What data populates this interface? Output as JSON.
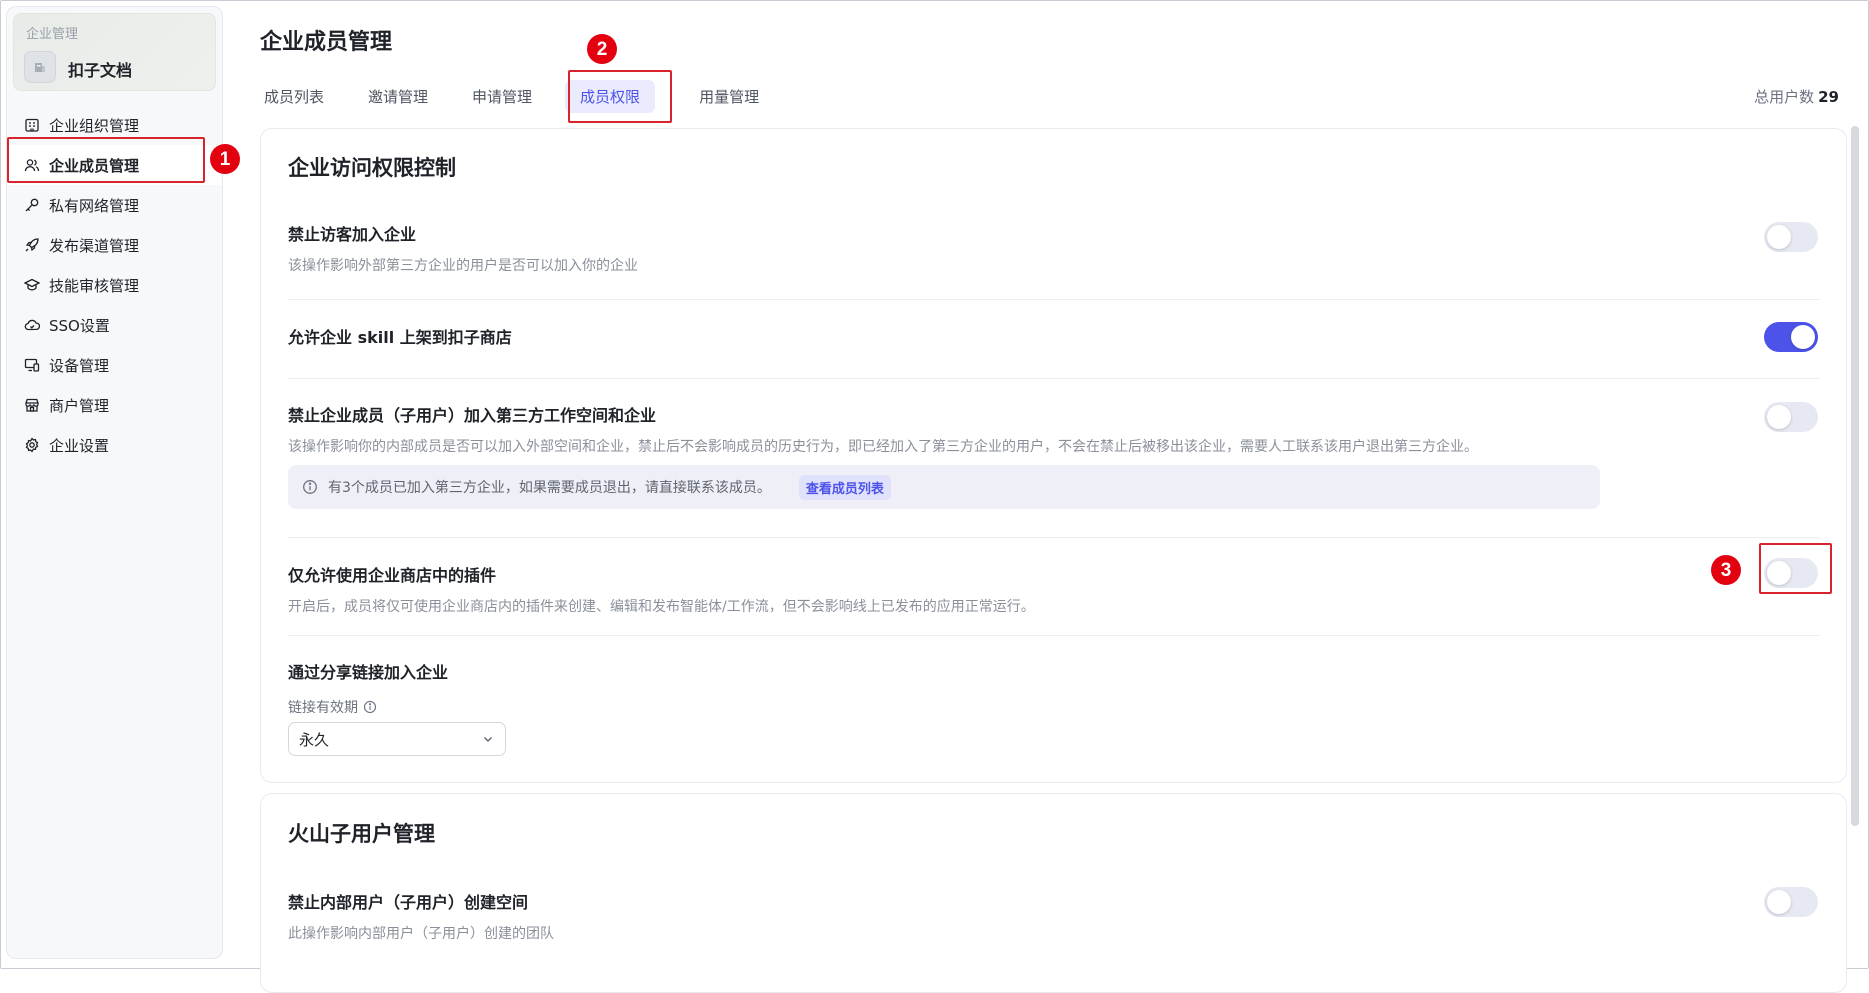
{
  "sidebar": {
    "org_caption": "企业管理",
    "org_name": "扣子文档",
    "items": [
      {
        "label": "企业组织管理",
        "icon": "building-icon"
      },
      {
        "label": "企业成员管理",
        "icon": "users-icon"
      },
      {
        "label": "私有网络管理",
        "icon": "key-icon"
      },
      {
        "label": "发布渠道管理",
        "icon": "rocket-icon"
      },
      {
        "label": "技能审核管理",
        "icon": "graduation-cap-icon"
      },
      {
        "label": "SSO设置",
        "icon": "cloud-icon"
      },
      {
        "label": "设备管理",
        "icon": "devices-icon"
      },
      {
        "label": "商户管理",
        "icon": "store-icon"
      },
      {
        "label": "企业设置",
        "icon": "gear-icon"
      }
    ],
    "active_index": 1
  },
  "header": {
    "title": "企业成员管理",
    "tabs": [
      "成员列表",
      "邀请管理",
      "申请管理",
      "成员权限",
      "用量管理"
    ],
    "active_tab": 3,
    "total_label": "总用户数",
    "total_value": "29"
  },
  "annotations": {
    "badge_1": "1",
    "badge_2": "2",
    "badge_3": "3"
  },
  "access_control": {
    "title": "企业访问权限控制",
    "rows": [
      {
        "title": "禁止访客加入企业",
        "desc": "该操作影响外部第三方企业的用户是否可以加入你的企业",
        "enabled": false
      },
      {
        "title": "允许企业 skill 上架到扣子商店",
        "desc": "",
        "enabled": true
      },
      {
        "title": "禁止企业成员（子用户）加入第三方工作空间和企业",
        "desc": "该操作影响你的内部成员是否可以加入外部空间和企业，禁止后不会影响成员的历史行为，即已经加入了第三方企业的用户，不会在禁止后被移出该企业，需要人工联系该用户退出第三方企业。",
        "enabled": false
      },
      {
        "title": "仅允许使用企业商店中的插件",
        "desc": "开启后，成员将仅可使用企业商店内的插件来创建、编辑和发布智能体/工作流，但不会影响线上已发布的应用正常运行。",
        "enabled": false
      }
    ],
    "notice": {
      "text": "有3个成员已加入第三方企业，如果需要成员退出，请直接联系该成员。",
      "link": "查看成员列表"
    },
    "share_link": {
      "title": "通过分享链接加入企业",
      "validity_label": "链接有效期",
      "validity_value": "永久"
    }
  },
  "volcano": {
    "title": "火山子用户管理",
    "rows": [
      {
        "title": "禁止内部用户（子用户）创建空间",
        "desc": "此操作影响内部用户（子用户）创建的团队",
        "enabled": false
      }
    ]
  },
  "colors": {
    "accent": "#4d53e8",
    "annotation_red": "#e3000f"
  }
}
